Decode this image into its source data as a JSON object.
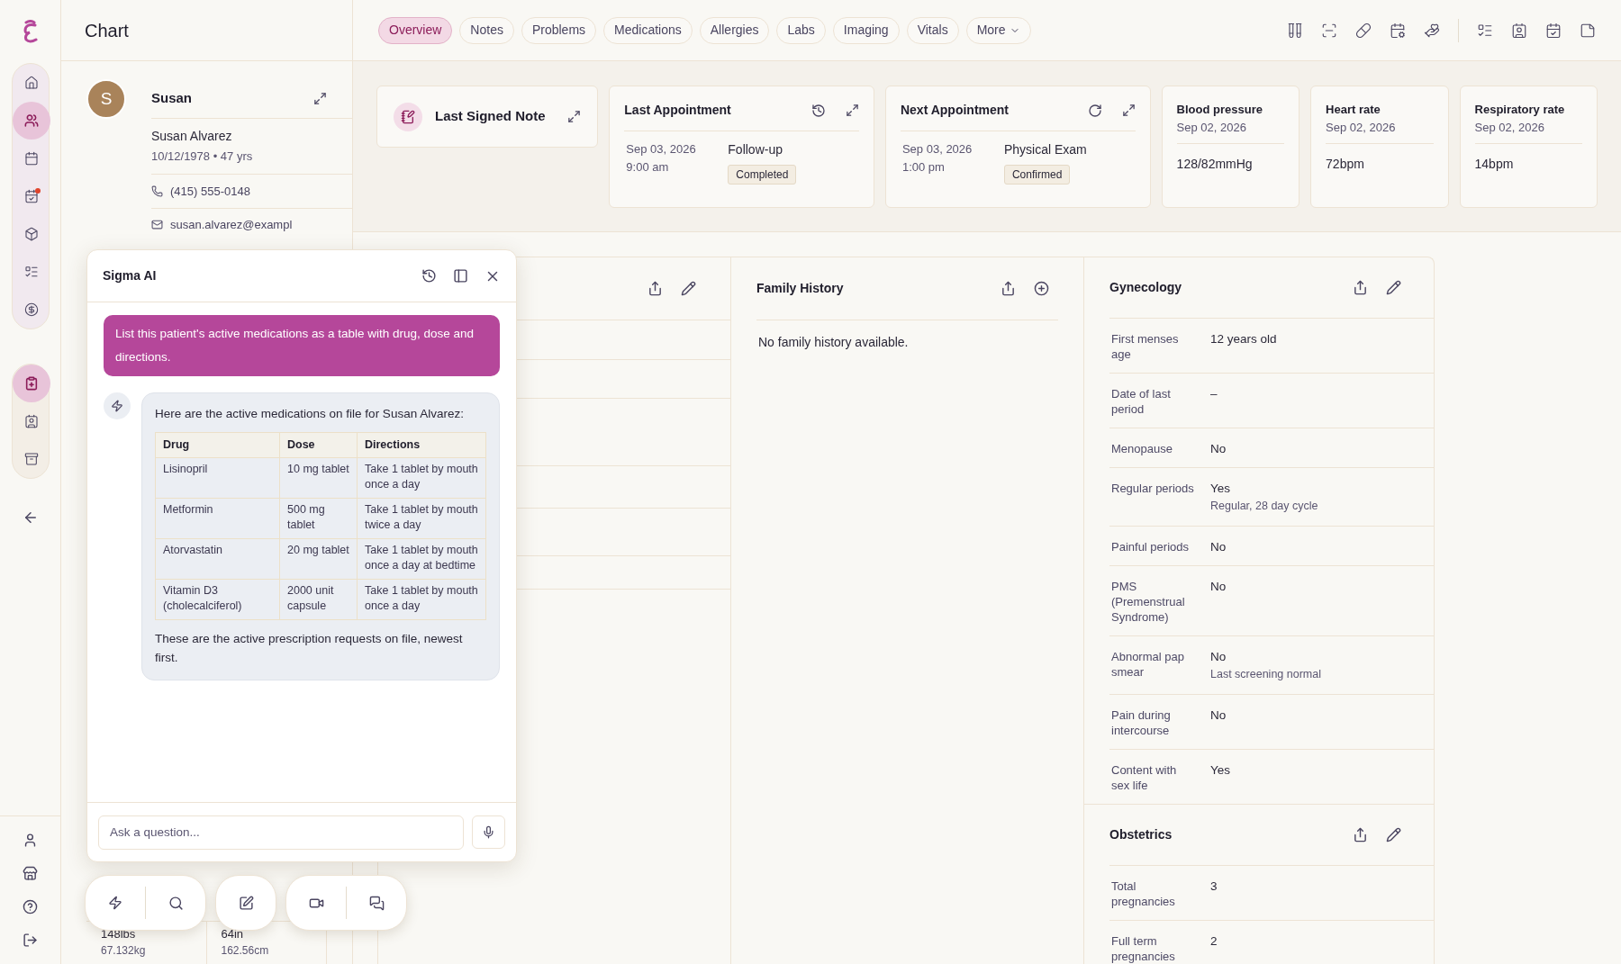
{
  "page_title": "Chart",
  "rail_groups": [
    [
      {
        "selected": false,
        "badge": false
      },
      {
        "selected": true,
        "badge": false
      },
      {
        "selected": false,
        "badge": false
      },
      {
        "selected": false,
        "badge": true
      },
      {
        "selected": false,
        "badge": false
      },
      {
        "selected": false,
        "badge": false
      },
      {
        "selected": false,
        "badge": false
      }
    ],
    [
      {
        "selected": true,
        "badge": false
      },
      {
        "selected": false,
        "badge": false
      },
      {
        "selected": false,
        "badge": false
      }
    ]
  ],
  "patient": {
    "initial": "S",
    "first_name": "Susan",
    "full_name": "Susan Alvarez",
    "dob_age": "10/12/1978 • 47 yrs",
    "phone": "(415) 555-0148",
    "email": "susan.alvarez@exampl"
  },
  "body_stats": [
    {
      "value": "148lbs",
      "sub": "67.132kg"
    },
    {
      "value": "64in",
      "sub": "162.56cm"
    }
  ],
  "tabs": [
    {
      "label": "Overview",
      "selected": true,
      "dropdown": false
    },
    {
      "label": "Notes",
      "selected": false,
      "dropdown": false
    },
    {
      "label": "Problems",
      "selected": false,
      "dropdown": false
    },
    {
      "label": "Medications",
      "selected": false,
      "dropdown": false
    },
    {
      "label": "Allergies",
      "selected": false,
      "dropdown": false
    },
    {
      "label": "Labs",
      "selected": false,
      "dropdown": false
    },
    {
      "label": "Imaging",
      "selected": false,
      "dropdown": false
    },
    {
      "label": "Vitals",
      "selected": false,
      "dropdown": false
    },
    {
      "label": "More",
      "selected": false,
      "dropdown": true
    }
  ],
  "last_note": {
    "title": "Last Signed Note"
  },
  "appointments": [
    {
      "title": "Last Appointment",
      "date": "Sep 03, 2026",
      "time": "9:00 am",
      "type": "Follow-up",
      "status": "Completed"
    },
    {
      "title": "Next Appointment",
      "date": "Sep 03, 2026",
      "time": "1:00 pm",
      "type": "Physical Exam",
      "status": "Confirmed"
    }
  ],
  "vitals": [
    {
      "name": "Blood pressure",
      "date": "Sep 02, 2026",
      "value": "128/82mmHg"
    },
    {
      "name": "Heart rate",
      "date": "Sep 02, 2026",
      "value": "72bpm"
    },
    {
      "name": "Respiratory rate",
      "date": "Sep 02, 2026",
      "value": "14bpm"
    }
  ],
  "family_history": {
    "title": "Family History",
    "empty_text": "No family history available."
  },
  "gynecology": {
    "title": "Gynecology",
    "rows": [
      {
        "label": "First menses age",
        "value": "12 years old"
      },
      {
        "label": "Date of last period",
        "value": "–"
      },
      {
        "label": "Menopause",
        "value": "No"
      },
      {
        "label": "Regular periods",
        "value": "Yes",
        "note": "Regular, 28 day cycle"
      },
      {
        "label": "Painful periods",
        "value": "No"
      },
      {
        "label": "PMS (Premenstrual Syndrome)",
        "value": "No"
      },
      {
        "label": "Abnormal pap smear",
        "value": "No",
        "note": "Last screening normal"
      },
      {
        "label": "Pain during intercourse",
        "value": "No"
      },
      {
        "label": "Content with sex life",
        "value": "Yes"
      }
    ]
  },
  "obstetrics": {
    "title": "Obstetrics",
    "rows": [
      {
        "label": "Total pregnancies",
        "value": "3"
      },
      {
        "label": "Full term pregnancies",
        "value": "2"
      }
    ]
  },
  "chat": {
    "title": "Sigma AI",
    "user_message": "List this patient's active medications as a table with drug, dose and directions.",
    "intro": "Here are the active medications on file for Susan Alvarez:",
    "table": {
      "columns": [
        "Drug",
        "Dose",
        "Directions"
      ],
      "rows": [
        [
          "Lisinopril",
          "10 mg tablet",
          "Take 1 tablet by mouth once a day"
        ],
        [
          "Metformin",
          "500 mg tablet",
          "Take 1 tablet by mouth twice a day"
        ],
        [
          "Atorvastatin",
          "20 mg tablet",
          "Take 1 tablet by mouth once a day at bedtime"
        ],
        [
          "Vitamin D3 (cholecalciferol)",
          "2000 unit capsule",
          "Take 1 tablet by mouth once a day"
        ]
      ]
    },
    "outro": "These are the active prescription requests on file, newest first.",
    "input": {
      "placeholder": "Ask a question..."
    }
  }
}
